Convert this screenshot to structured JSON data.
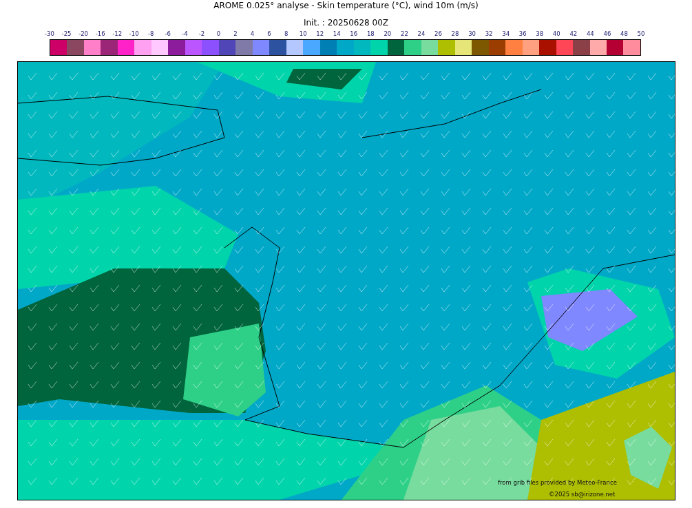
{
  "title": "AROME 0.025° analyse - Skin temperature (°C), wind 10m (m/s)",
  "subtitle": "Init. : 20250628 00Z",
  "colorbar": {
    "ticks": [
      "-30",
      "-25",
      "-20",
      "-16",
      "-12",
      "-10",
      "-8",
      "-6",
      "-4",
      "-2",
      "0",
      "2",
      "4",
      "6",
      "8",
      "10",
      "12",
      "14",
      "16",
      "18",
      "20",
      "22",
      "24",
      "26",
      "28",
      "30",
      "32",
      "34",
      "36",
      "38",
      "40",
      "42",
      "44",
      "46",
      "48",
      "50"
    ],
    "bins": [
      {
        "color": "#cc0066"
      },
      {
        "color": "#8b4660"
      },
      {
        "color": "#ff80c8"
      },
      {
        "color": "#9b2677"
      },
      {
        "color": "#ff22c8"
      },
      {
        "color": "#ffa0f0"
      },
      {
        "color": "#ffc8ff"
      },
      {
        "color": "#8c1c9c"
      },
      {
        "color": "#bb55ff"
      },
      {
        "color": "#8c50ff"
      },
      {
        "color": "#5046b8"
      },
      {
        "color": "#7f7aa8"
      },
      {
        "color": "#8088ff"
      },
      {
        "color": "#2d52a0"
      },
      {
        "color": "#b4c8ff"
      },
      {
        "color": "#4ba8ff"
      },
      {
        "color": "#007fb4"
      },
      {
        "color": "#00a8c8"
      },
      {
        "color": "#00b8be"
      },
      {
        "color": "#00d4aa"
      },
      {
        "color": "#00643c"
      },
      {
        "color": "#2ed088"
      },
      {
        "color": "#78dc9e"
      },
      {
        "color": "#aebe00"
      },
      {
        "color": "#e6e678"
      },
      {
        "color": "#7d5800"
      },
      {
        "color": "#9b3c00"
      },
      {
        "color": "#ff8040"
      },
      {
        "color": "#ffa080"
      },
      {
        "color": "#aa1000"
      },
      {
        "color": "#ff4656"
      },
      {
        "color": "#8b4048"
      },
      {
        "color": "#ffaaaa"
      },
      {
        "color": "#b40032"
      },
      {
        "color": "#ff8c9c"
      }
    ]
  },
  "map": {
    "credit": "from grib files provided by Meteo-France",
    "copyright": "©2025 sb@irizone.net"
  }
}
